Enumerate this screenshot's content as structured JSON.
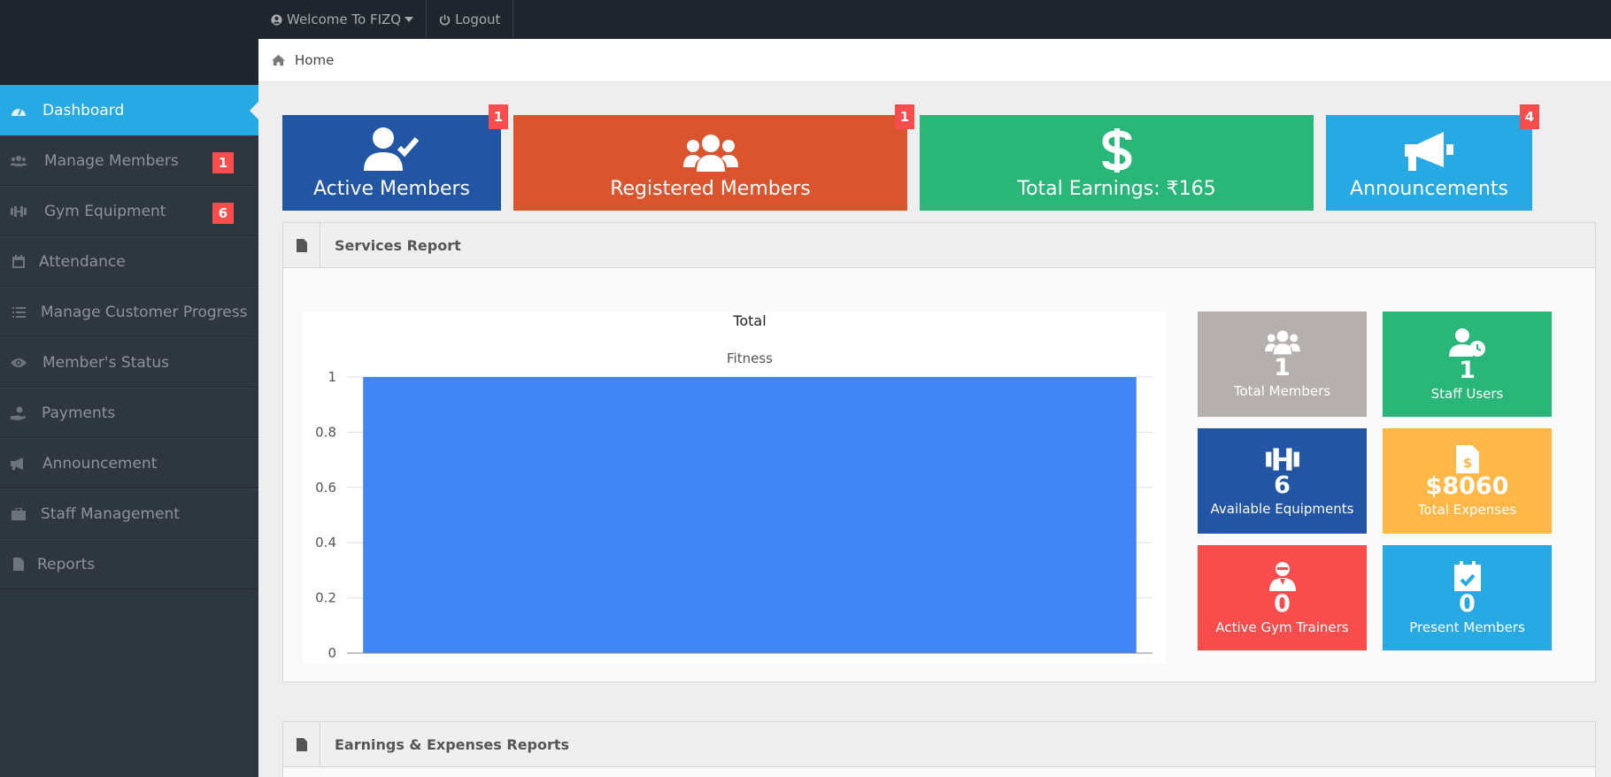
{
  "topbar": {
    "welcome_label": "Welcome To FIZQ",
    "logout_label": "Logout"
  },
  "breadcrumb": {
    "home_label": "Home"
  },
  "sidebar": {
    "items": [
      {
        "label": "Dashboard",
        "icon": "dashboard-icon",
        "active": true
      },
      {
        "label": "Manage Members",
        "icon": "users-icon",
        "badge": "1"
      },
      {
        "label": "Gym Equipment",
        "icon": "dumbbell-icon",
        "badge": "6"
      },
      {
        "label": "Attendance",
        "icon": "calendar-icon"
      },
      {
        "label": "Manage Customer Progress",
        "icon": "list-icon"
      },
      {
        "label": "Member's Status",
        "icon": "eye-icon"
      },
      {
        "label": "Payments",
        "icon": "hand-coin-icon"
      },
      {
        "label": "Announcement",
        "icon": "bullhorn-icon"
      },
      {
        "label": "Staff Management",
        "icon": "briefcase-icon"
      },
      {
        "label": "Reports",
        "icon": "file-icon"
      }
    ]
  },
  "tiles": [
    {
      "label": "Active Members",
      "badge": "1",
      "color": "#2255a4",
      "icon": "user-check-icon"
    },
    {
      "label": "Registered Members",
      "badge": "1",
      "color": "#da542e",
      "icon": "users-icon"
    },
    {
      "label": "Total Earnings: ₹165",
      "color": "#28b779",
      "icon": "dollar-icon"
    },
    {
      "label": "Announcements",
      "badge": "4",
      "color": "#27a9e3",
      "icon": "bullhorn-icon"
    }
  ],
  "services_report": {
    "title": "Services Report",
    "stats": [
      {
        "value": "1",
        "label": "Total Members",
        "color": "#b5b0ad",
        "icon": "users-icon"
      },
      {
        "value": "1",
        "label": "Staff Users",
        "color": "#28b779",
        "icon": "user-clock-icon"
      },
      {
        "value": "6",
        "label": "Available Equipments",
        "color": "#2255a4",
        "icon": "dumbbell-icon"
      },
      {
        "value": "$8060",
        "label": "Total Expenses",
        "color": "#ffb848",
        "icon": "invoice-dollar-icon"
      },
      {
        "value": "0",
        "label": "Active Gym Trainers",
        "color": "#f74d4d",
        "icon": "trainer-icon"
      },
      {
        "value": "0",
        "label": "Present Members",
        "color": "#27a9e3",
        "icon": "calendar-check-icon"
      }
    ]
  },
  "earnings_report": {
    "title": "Earnings & Expenses Reports"
  },
  "chart_data": {
    "type": "bar",
    "title": "Total",
    "series": [
      {
        "name": "Fitness",
        "values": [
          1
        ]
      }
    ],
    "categories": [
      ""
    ],
    "ylim": [
      0,
      1
    ],
    "yticks": [
      "0",
      "0.2",
      "0.4",
      "0.6",
      "0.8",
      "1"
    ],
    "grid": true,
    "bar_color": "#4285f4"
  }
}
